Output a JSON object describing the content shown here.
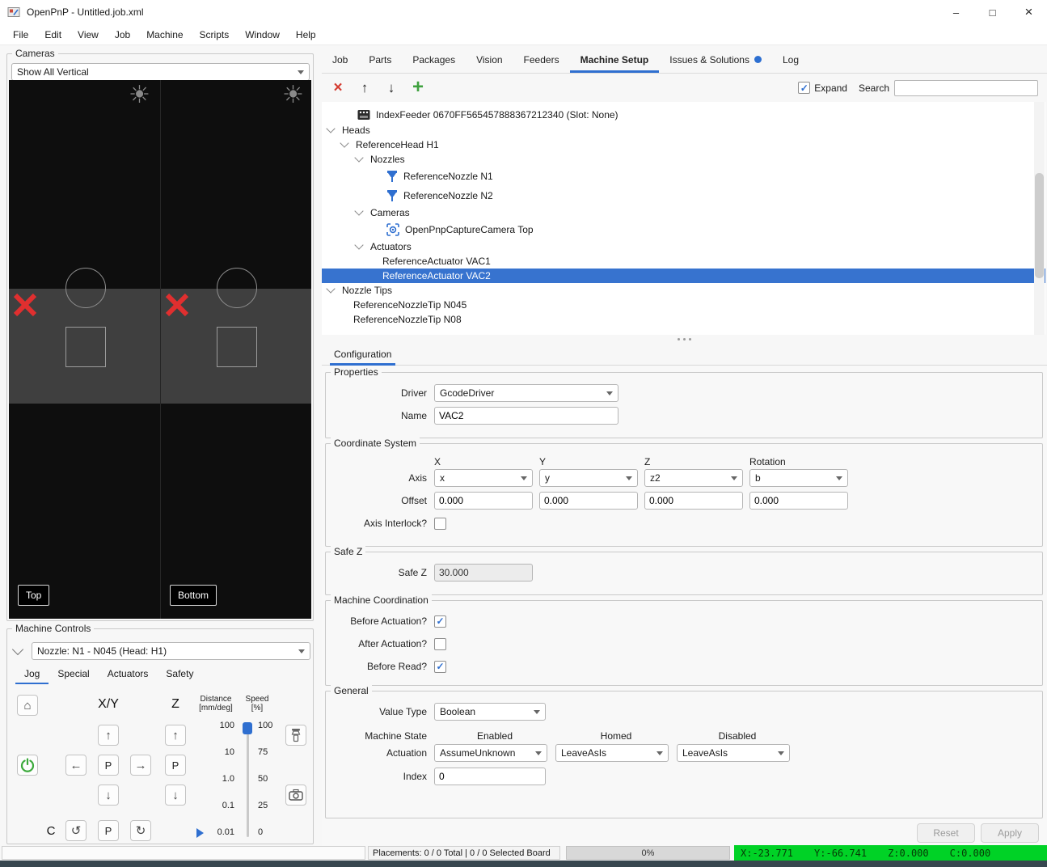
{
  "window": {
    "title": "OpenPnP - Untitled.job.xml"
  },
  "icons": {
    "window_minimize": "–",
    "window_maximize": "□",
    "window_close": "×",
    "delete": "×",
    "move_up": "↑",
    "move_down": "↓",
    "add": "+",
    "home": "⌂",
    "rotate_ccw": "↺",
    "rotate_cw": "↻",
    "brightness": "☀",
    "checkmark": "✓"
  },
  "menubar": {
    "items": [
      "File",
      "Edit",
      "View",
      "Job",
      "Machine",
      "Scripts",
      "Window",
      "Help"
    ]
  },
  "cameras_panel": {
    "title": "Cameras",
    "view_selector": "Show All Vertical",
    "feeds": [
      {
        "label": "Top"
      },
      {
        "label": "Bottom"
      }
    ]
  },
  "machine_controls": {
    "title": "Machine Controls",
    "tool_selector": "Nozzle: N1 - N045 (Head: H1)",
    "tabs": [
      "Jog",
      "Special",
      "Actuators",
      "Safety"
    ],
    "active_tab": "Jog",
    "jog": {
      "xy_label": "X/Y",
      "z_label": "Z",
      "c_label": "C",
      "park_label": "P",
      "distance": {
        "label_line1": "Distance",
        "label_line2": "[mm/deg]",
        "ticks": [
          "100",
          "10",
          "1.0",
          "0.1",
          "0.01"
        ],
        "value": "0.01"
      },
      "speed": {
        "label_line1": "Speed",
        "label_line2": "[%]",
        "ticks": [
          "100",
          "75",
          "50",
          "25",
          "0"
        ],
        "value": "100"
      }
    }
  },
  "main_tabs": {
    "labels": [
      "Job",
      "Parts",
      "Packages",
      "Vision",
      "Feeders",
      "Machine Setup",
      "Issues & Solutions",
      "Log"
    ],
    "active": "Machine Setup",
    "badge_tab": "Issues & Solutions"
  },
  "tree_toolbar": {
    "expand_label": "Expand",
    "expand_checked": true,
    "search_label": "Search",
    "search_value": ""
  },
  "machine_tree": {
    "items": [
      {
        "label": "IndexFeeder 0670FF565457888367212340 (Slot: None)",
        "icon": "feeder"
      },
      {
        "label": "Heads",
        "expanded": true
      },
      {
        "label": "ReferenceHead H1",
        "expanded": true
      },
      {
        "label": "Nozzles",
        "expanded": true
      },
      {
        "label": "ReferenceNozzle N1",
        "icon": "nozzle"
      },
      {
        "label": "ReferenceNozzle N2",
        "icon": "nozzle"
      },
      {
        "label": "Cameras",
        "expanded": true
      },
      {
        "label": "OpenPnpCaptureCamera Top",
        "icon": "camera"
      },
      {
        "label": "Actuators",
        "expanded": true
      },
      {
        "label": "ReferenceActuator VAC1"
      },
      {
        "label": "ReferenceActuator VAC2",
        "selected": true
      },
      {
        "label": "Nozzle Tips",
        "expanded": true
      },
      {
        "label": "ReferenceNozzleTip N045"
      },
      {
        "label": "ReferenceNozzleTip N08"
      }
    ]
  },
  "configuration": {
    "tab_label": "Configuration",
    "properties": {
      "title": "Properties",
      "driver_label": "Driver",
      "driver_value": "GcodeDriver",
      "name_label": "Name",
      "name_value": "VAC2"
    },
    "coordinate_system": {
      "title": "Coordinate System",
      "columns": [
        "X",
        "Y",
        "Z",
        "Rotation"
      ],
      "axis_label": "Axis",
      "axis_values": [
        "x",
        "y",
        "z2",
        "b"
      ],
      "offset_label": "Offset",
      "offset_values": [
        "0.000",
        "0.000",
        "0.000",
        "0.000"
      ],
      "axis_interlock_label": "Axis Interlock?",
      "axis_interlock_checked": false
    },
    "safe_z": {
      "title": "Safe Z",
      "label": "Safe Z",
      "value": "30.000"
    },
    "machine_coordination": {
      "title": "Machine Coordination",
      "rows": [
        {
          "label": "Before Actuation?",
          "checked": true
        },
        {
          "label": "After Actuation?",
          "checked": false
        },
        {
          "label": "Before Read?",
          "checked": true
        }
      ]
    },
    "general": {
      "title": "General",
      "value_type_label": "Value Type",
      "value_type_value": "Boolean",
      "machine_state_label": "Machine State",
      "state_columns": [
        "Enabled",
        "Homed",
        "Disabled"
      ],
      "actuation_label": "Actuation",
      "actuation_values": [
        "AssumeUnknown",
        "LeaveAsIs",
        "LeaveAsIs"
      ],
      "index_label": "Index",
      "index_value": "0"
    },
    "buttons": {
      "reset": "Reset",
      "apply": "Apply"
    }
  },
  "status_bar": {
    "placements": "Placements: 0 / 0 Total | 0 / 0 Selected Board",
    "progress": "0%",
    "coords": {
      "x": "X:-23.771",
      "y": "Y:-66.741",
      "z": "Z:0.000",
      "c": "C:0.000"
    }
  }
}
